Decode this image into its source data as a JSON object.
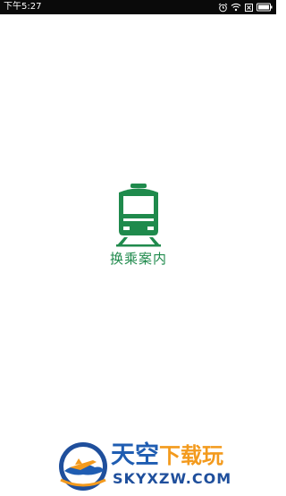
{
  "status_bar": {
    "time": "下午5:27",
    "icons": [
      "alarm-icon",
      "wifi-icon",
      "sim-absent-icon",
      "battery-icon"
    ]
  },
  "splash": {
    "app_name": "换乘案内",
    "logo_icon": "train-icon",
    "brand_color": "#1f8a4c"
  },
  "watermark": {
    "title_part1": "天空",
    "title_part2": "下载玩",
    "url": "SKYXZW.COM",
    "colors": {
      "blue": "#1f5db2",
      "orange": "#f39a1d"
    }
  }
}
